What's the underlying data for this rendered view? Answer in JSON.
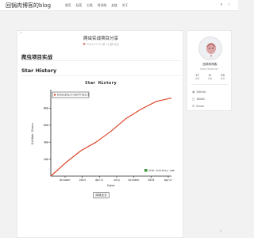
{
  "site": {
    "title": "回锅肉博客的blog"
  },
  "nav": {
    "items": [
      "首页",
      "标签",
      "分类",
      "时间线",
      "友链",
      "关于"
    ],
    "search_icon": "search-icon",
    "theme_icon": "moon-icon"
  },
  "post": {
    "title": "爬虫实战项目分享",
    "meta": "📅 2024-07-30  👁 1k  💬 评论",
    "section_title": "爬虫项目实战",
    "subsection_title": "Star History",
    "read_more": "阅读全文",
    "corner_icon": "arrow-icon"
  },
  "sidebar": {
    "name": "回锅肉博客",
    "bio": "keep learning~",
    "stats": [
      {
        "value": "17",
        "label": "文章"
      },
      {
        "value": "8",
        "label": "分类"
      },
      {
        "value": "39",
        "label": "标签"
      }
    ],
    "links": [
      {
        "icon": "github-icon",
        "label": "GitHub"
      },
      {
        "icon": "bilibili-icon",
        "label": "Bilibili"
      },
      {
        "icon": "email-icon",
        "label": "Email"
      }
    ]
  },
  "chart_data": {
    "type": "line",
    "title": "Star History",
    "xlabel": "Date",
    "ylabel": "GitHub Stars",
    "watermark": "star-history.com",
    "series": [
      {
        "name": "Kimoushe/CrawlProject",
        "color": "#dd4528",
        "x": [
          "2023-08",
          "2023-10",
          "2024-01",
          "2024-04",
          "2024-07",
          "2024-10",
          "2025-01",
          "2025-04",
          "2025-05"
        ],
        "values": [
          0,
          160,
          300,
          400,
          530,
          680,
          790,
          880,
          920
        ]
      }
    ],
    "x_ticks": [
      "October",
      "2024",
      "April",
      "July",
      "October",
      "2025",
      "April"
    ],
    "y_ticks": [
      "200",
      "400",
      "600",
      "800"
    ],
    "ylim": [
      0,
      1000
    ],
    "legend": "top-left",
    "grid": false
  }
}
